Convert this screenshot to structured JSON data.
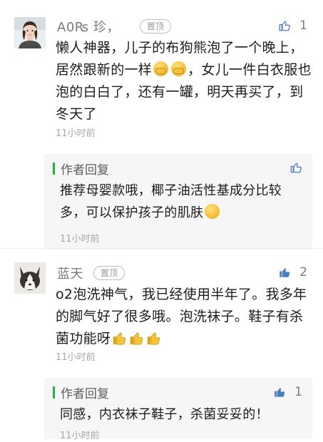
{
  "comments": [
    {
      "name": "A0₨ 珍，",
      "pin_badge": "置顶",
      "like_count": "1",
      "text_parts": [
        "懒人神器，儿子的布狗熊泡了一个晚上，居然跟新的一样",
        "，女儿一件白衣服也泡的白白了，还有一罐，明天再买了，到冬天了"
      ],
      "timestamp": "11小时前",
      "avatar_icon": "woman-portrait-avatar",
      "reply": {
        "title": "作者回复",
        "text": "推荐母婴款哦，椰子油活性基成分比较多，可以保护孩子的肌肤",
        "timestamp": "11小时前",
        "like_count": ""
      }
    },
    {
      "name": "蓝天",
      "pin_badge": "置顶",
      "like_count": "2",
      "text": "o2泡洗神气，我已经使用半年了。我多年的脚气好了很多哦。泡洗袜子。鞋子有杀菌功能呀",
      "timestamp": "11小时前",
      "avatar_icon": "corgi-dog-avatar",
      "reply": {
        "title": "作者回复",
        "text": "同感，内衣袜子鞋子，杀菌妥妥的！",
        "timestamp": "11小时前",
        "like_count": "1"
      }
    }
  ],
  "colors": {
    "accent_green": "#25b33d",
    "like_blue": "#4a7ec2",
    "reply_bg": "#f6f6f6",
    "meta_gray": "#a8a8a8"
  }
}
